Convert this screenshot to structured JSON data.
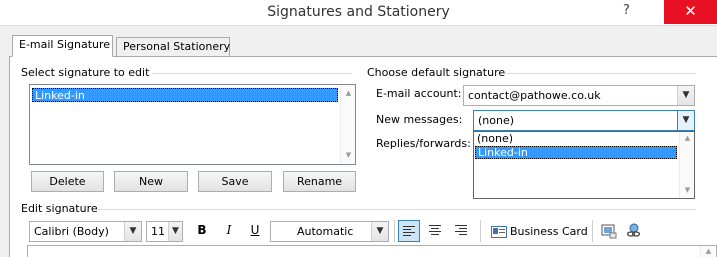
{
  "window": {
    "title": "Signatures and Stationery",
    "help_glyph": "?",
    "close_glyph": "✕"
  },
  "tabs": [
    {
      "label": "E-mail Signature",
      "active": true
    },
    {
      "label": "Personal Stationery",
      "active": false
    }
  ],
  "select_signature": {
    "group_label": "Select signature to edit",
    "items": [
      "Linked-in"
    ],
    "selected": "Linked-in"
  },
  "signature_buttons": {
    "delete": "Delete",
    "new": "New",
    "save": "Save",
    "rename": "Rename"
  },
  "default_signature": {
    "group_label": "Choose default signature",
    "email_account_label": "E-mail account:",
    "email_account_value": "contact@pathowe.co.uk",
    "new_messages_label": "New messages:",
    "new_messages_value": "(none)",
    "replies_label": "Replies/forwards:",
    "dropdown_options": [
      "(none)",
      "Linked-in"
    ],
    "dropdown_highlighted": "Linked-in"
  },
  "edit_signature": {
    "group_label": "Edit signature",
    "font_name": "Calibri (Body)",
    "font_size": "11",
    "bold": "B",
    "italic": "I",
    "underline": "U",
    "font_color": "Automatic",
    "business_card_label": "Business Card"
  },
  "colors": {
    "selection": "#3399ff",
    "close_button": "#e81123",
    "active_toggle": "#cce4f7"
  }
}
